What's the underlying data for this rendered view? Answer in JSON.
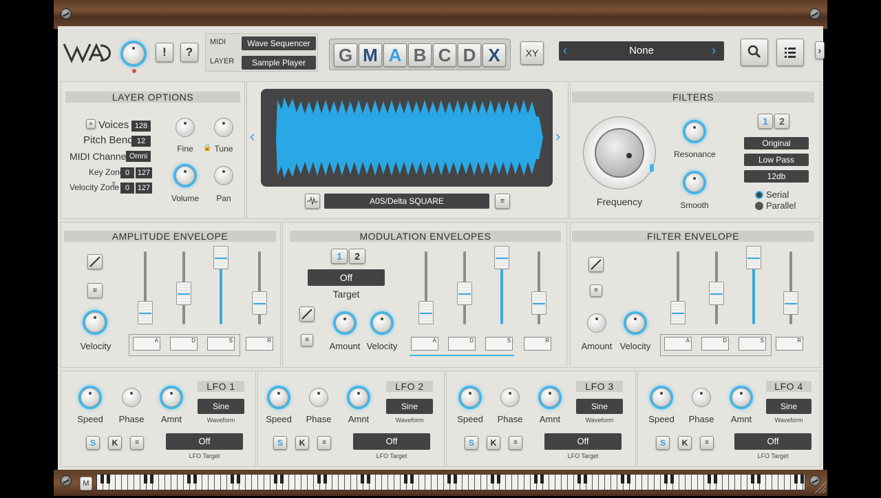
{
  "header": {
    "help_q": "?",
    "help_ex": "!",
    "midi_label": "MIDI",
    "midi_value": "Wave Sequencer",
    "layer_label": "LAYER",
    "layer_value": "Sample Player",
    "tabs": [
      "G",
      "M",
      "A",
      "B",
      "C",
      "D",
      "X"
    ],
    "xy_label": "XY",
    "preset": "None"
  },
  "layer_options": {
    "title": "LAYER OPTIONS",
    "voices_label": "Voices",
    "voices": "128",
    "pitchbend_label": "Pitch Bend",
    "pitchbend": "12",
    "midichannel_label": "MIDI Channel",
    "midichannel": "Omni",
    "keyzone_label": "Key Zone",
    "keyzone_lo": "0",
    "keyzone_hi": "127",
    "velzone_label": "Velocity Zone",
    "velzone_lo": "0",
    "velzone_hi": "127",
    "fine": "Fine",
    "tune": "Tune",
    "volume": "Volume",
    "pan": "Pan"
  },
  "wave": {
    "name": "A0S/Delta SQUARE"
  },
  "filters": {
    "title": "FILTERS",
    "frequency": "Frequency",
    "resonance": "Resonance",
    "smooth": "Smooth",
    "tab1": "1",
    "tab2": "2",
    "mode": "Original",
    "type": "Low Pass",
    "slope": "12db",
    "serial": "Serial",
    "parallel": "Parallel"
  },
  "amp_env": {
    "title": "AMPLITUDE ENVELOPE",
    "velocity": "Velocity"
  },
  "mod_env": {
    "title": "MODULATION ENVELOPES",
    "tab1": "1",
    "tab2": "2",
    "target_value": "Off",
    "target_label": "Target",
    "amount": "Amount",
    "velocity": "Velocity"
  },
  "filt_env": {
    "title": "FILTER ENVELOPE",
    "amount": "Amount",
    "velocity": "Velocity"
  },
  "env_shapes": [
    "A",
    "D",
    "S",
    "R"
  ],
  "lfos": [
    {
      "title": "LFO 1",
      "speed": "Speed",
      "phase": "Phase",
      "amnt": "Amnt",
      "waveform": "Sine",
      "waveform_label": "Waveform",
      "s": "S",
      "k": "K",
      "target": "Off",
      "target_label": "LFO Target"
    },
    {
      "title": "LFO 2",
      "speed": "Speed",
      "phase": "Phase",
      "amnt": "Amnt",
      "waveform": "Sine",
      "waveform_label": "Waveform",
      "s": "S",
      "k": "K",
      "target": "Off",
      "target_label": "LFO Target"
    },
    {
      "title": "LFO 3",
      "speed": "Speed",
      "phase": "Phase",
      "amnt": "Amnt",
      "waveform": "Sine",
      "waveform_label": "Waveform",
      "s": "S",
      "k": "K",
      "target": "Off",
      "target_label": "LFO Target"
    },
    {
      "title": "LFO 4",
      "speed": "Speed",
      "phase": "Phase",
      "amnt": "Amnt",
      "waveform": "Sine",
      "waveform_label": "Waveform",
      "s": "S",
      "k": "K",
      "target": "Off",
      "target_label": "LFO Target"
    }
  ],
  "keyboard": {
    "m_label": "M"
  },
  "colors": {
    "accent": "#39b8f0",
    "wave": "#2aa8e6",
    "dark": "#434343"
  }
}
